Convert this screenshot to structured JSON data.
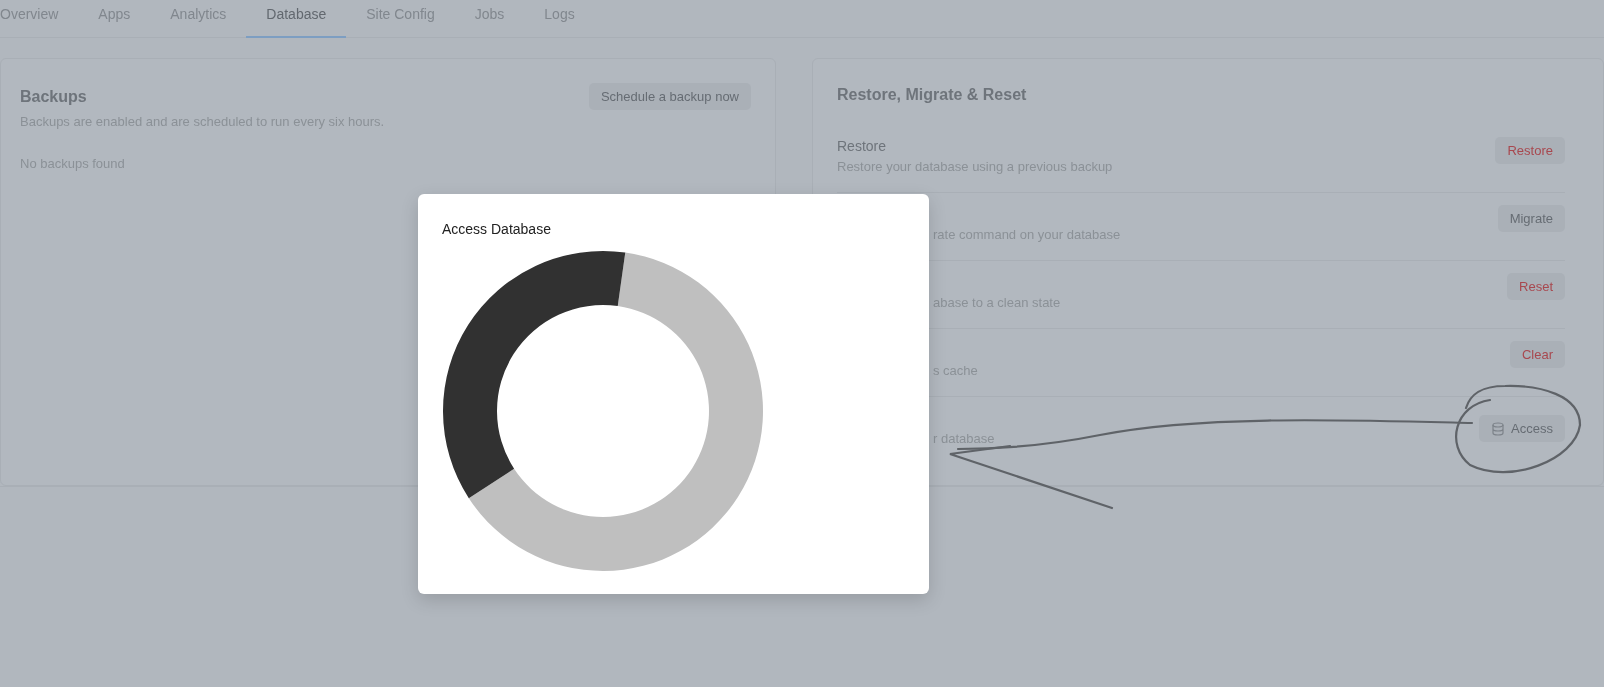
{
  "tabs": [
    {
      "label": "Overview",
      "selected": false
    },
    {
      "label": "Apps",
      "selected": false
    },
    {
      "label": "Analytics",
      "selected": false
    },
    {
      "label": "Database",
      "selected": true
    },
    {
      "label": "Site Config",
      "selected": false
    },
    {
      "label": "Jobs",
      "selected": false
    },
    {
      "label": "Logs",
      "selected": false
    }
  ],
  "backups": {
    "title": "Backups",
    "button": "Schedule a backup now",
    "description": "Backups are enabled and are scheduled to run every six hours.",
    "empty": "No backups found"
  },
  "restore_panel": {
    "title": "Restore, Migrate & Reset",
    "rows": [
      {
        "title": "Restore",
        "description": "Restore your database using a previous backup",
        "button": {
          "label": "Restore",
          "kind": "danger"
        }
      },
      {
        "description": "rate command on your database",
        "button": {
          "label": "Migrate",
          "kind": "plain"
        }
      },
      {
        "description": "abase to a clean state",
        "button": {
          "label": "Reset",
          "kind": "danger"
        }
      },
      {
        "description": "s cache",
        "button": {
          "label": "Clear",
          "kind": "danger"
        }
      },
      {
        "description": "r database",
        "button": {
          "label": "Access",
          "kind": "with-icon"
        }
      }
    ]
  },
  "modal": {
    "title": "Access Database"
  }
}
